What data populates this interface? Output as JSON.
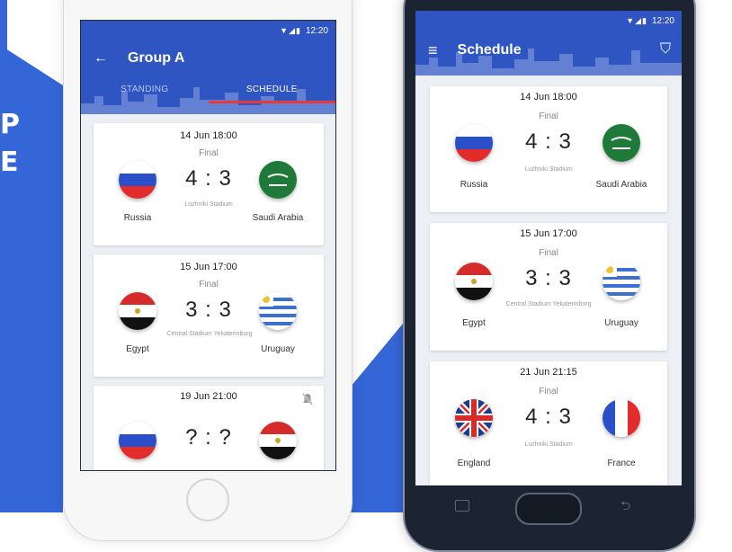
{
  "promo": {
    "line1": "P",
    "line2": "E"
  },
  "left_phone": {
    "status": {
      "time": "12:20",
      "icons": "▼◢▮"
    },
    "back_icon": "←",
    "title": "Group A",
    "tabs": [
      {
        "label": "STANDING"
      },
      {
        "label": "SCHEDULE"
      }
    ],
    "matches": [
      {
        "date": "14 Jun 18:00",
        "status": "Final",
        "home_score": "4",
        "away_score": "3",
        "venue": "Luzhniki Stadium",
        "home": {
          "name": "Russia",
          "flag": "russia"
        },
        "away": {
          "name": "Saudi Arabia",
          "flag": "saudi-arabia"
        }
      },
      {
        "date": "15 Jun 17:00",
        "status": "Final",
        "home_score": "3",
        "away_score": "3",
        "venue": "Central Stadium Yekaterinburg",
        "home": {
          "name": "Egypt",
          "flag": "egypt"
        },
        "away": {
          "name": "Uruguay",
          "flag": "uruguay"
        }
      },
      {
        "date": "19 Jun 21:00",
        "status": "",
        "home_score": "?",
        "away_score": "?",
        "venue": "",
        "home": {
          "name": "",
          "flag": "russia"
        },
        "away": {
          "name": "",
          "flag": "egypt"
        },
        "icon": "bell-off-icon"
      }
    ]
  },
  "right_phone": {
    "status": {
      "time": "12:20",
      "icons": "▼◢▮"
    },
    "menu_icon": "≡",
    "title": "Schedule",
    "filter_icon": "⛉",
    "matches": [
      {
        "date": "14 Jun 18:00",
        "status": "Final",
        "home_score": "4",
        "away_score": "3",
        "venue": "Luzhniki Stadium",
        "home": {
          "name": "Russia",
          "flag": "russia"
        },
        "away": {
          "name": "Saudi Arabia",
          "flag": "saudi-arabia"
        }
      },
      {
        "date": "15 Jun 17:00",
        "status": "Final",
        "home_score": "3",
        "away_score": "3",
        "venue": "Central Stadium Yekaterinburg",
        "home": {
          "name": "Egypt",
          "flag": "egypt"
        },
        "away": {
          "name": "Uruguay",
          "flag": "uruguay"
        }
      },
      {
        "date": "21 Jun 21:15",
        "status": "Final",
        "home_score": "4",
        "away_score": "3",
        "venue": "Luzhniki Stadium",
        "home": {
          "name": "England",
          "flag": "england"
        },
        "away": {
          "name": "France",
          "flag": "france"
        }
      }
    ]
  },
  "colors": {
    "primary": "#2f55c3",
    "accent": "#e43a3a",
    "promo_blue": "#3566d8"
  }
}
